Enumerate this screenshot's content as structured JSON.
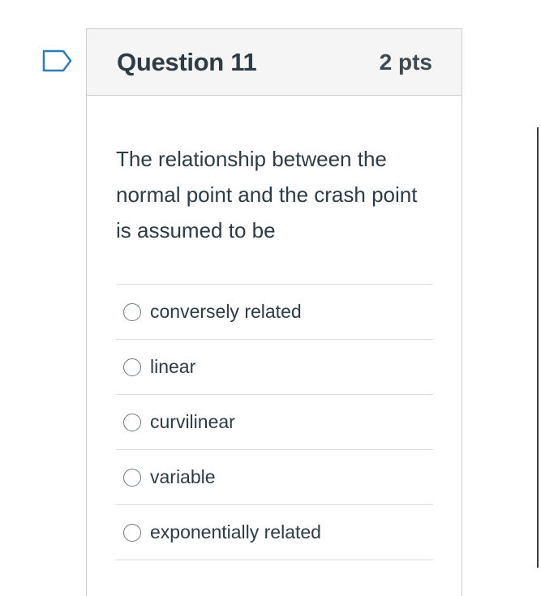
{
  "question": {
    "title": "Question 11",
    "points": "2 pts",
    "text": "The relationship between the normal point and the crash point is assumed to be",
    "flag_icon": "flag-outline-icon"
  },
  "answers": [
    {
      "label": "conversely related",
      "selected": false
    },
    {
      "label": "linear",
      "selected": false
    },
    {
      "label": "curvilinear",
      "selected": false
    },
    {
      "label": "variable",
      "selected": false
    },
    {
      "label": "exponentially related",
      "selected": false
    }
  ],
  "colors": {
    "text": "#2d3b45",
    "header_bg": "#f5f5f5",
    "border": "#c7cdd1",
    "flag": "#2d7bb8"
  }
}
